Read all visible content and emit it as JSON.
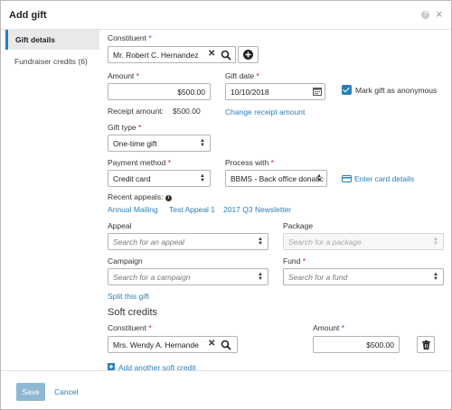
{
  "dialog": {
    "title": "Add gift",
    "help_glyph": "?",
    "close_glyph": "×"
  },
  "tabs": [
    {
      "label": "Gift details"
    },
    {
      "label": "Fundraiser credits (6)"
    }
  ],
  "constituent": {
    "label": "Constituent",
    "required": "*",
    "value": "Mr. Robert C. Hernandez"
  },
  "amount": {
    "label": "Amount",
    "required": "*",
    "value": "$500.00"
  },
  "gift_date": {
    "label": "Gift date",
    "required": "*",
    "value": "10/10/2018"
  },
  "anonymous": {
    "label": "Mark gift as anonymous",
    "checked": true
  },
  "receipt": {
    "label": "Receipt amount:",
    "value": "$500.00",
    "change_link": "Change receipt amount"
  },
  "gift_type": {
    "label": "Gift type",
    "required": "*",
    "value": "One-time gift"
  },
  "payment_method": {
    "label": "Payment method",
    "required": "*",
    "value": "Credit card"
  },
  "process_with": {
    "label": "Process with",
    "required": "*",
    "value": "BBMS - Back office donatic",
    "card_link": "Enter card details"
  },
  "recent_appeals": {
    "label": "Recent appeals:",
    "items": [
      "Annual Mailing",
      "Test Appeal 1",
      "2017 Q3 Newsletter"
    ]
  },
  "appeal": {
    "label": "Appeal",
    "placeholder": "Search for an appeal"
  },
  "package": {
    "label": "Package",
    "placeholder": "Search for a package"
  },
  "campaign": {
    "label": "Campaign",
    "placeholder": "Search for a campaign"
  },
  "fund": {
    "label": "Fund",
    "required": "*",
    "placeholder": "Search for a fund"
  },
  "split_link": "Split this gift",
  "soft_credits": {
    "title": "Soft credits",
    "constituent_label": "Constituent",
    "constituent_required": "*",
    "constituent_value": "Mrs. Wendy A. Hernande",
    "amount_label": "Amount",
    "amount_required": "*",
    "amount_value": "$500.00",
    "add_link": "Add another soft credit"
  },
  "footer": {
    "save": "Save",
    "cancel": "Cancel"
  },
  "colors": {
    "accent": "#2a7fb6",
    "required": "#c21d2b",
    "save_disabled": "#8fb8d4"
  }
}
